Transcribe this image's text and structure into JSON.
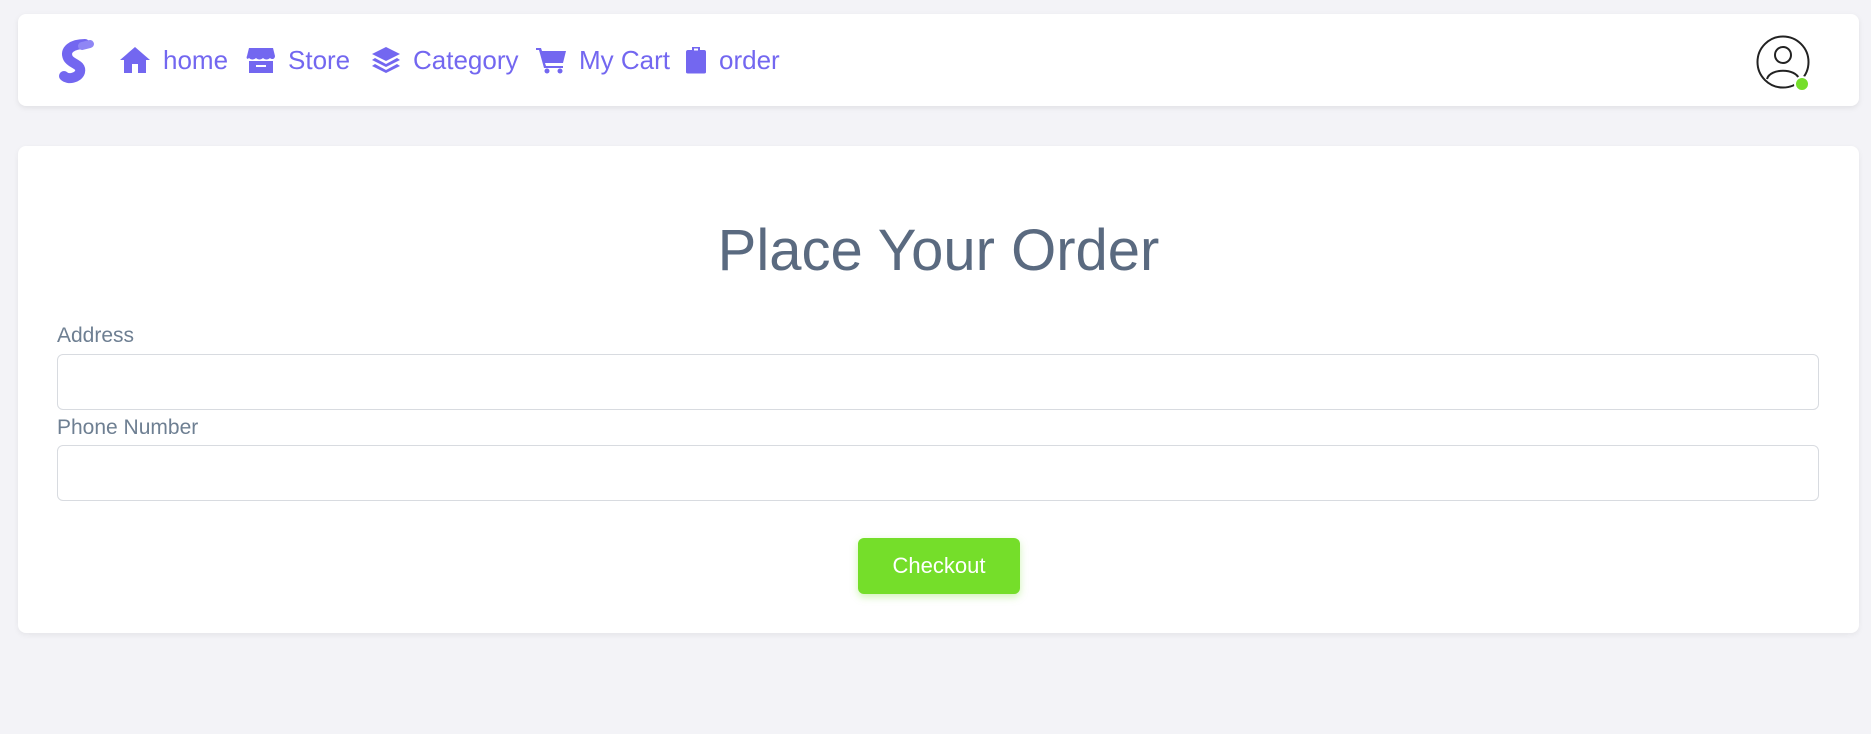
{
  "nav": {
    "logo_icon": "brand-s-logo",
    "items": [
      {
        "label": "home",
        "icon": "home-icon"
      },
      {
        "label": "Store",
        "icon": "store-icon"
      },
      {
        "label": "Category",
        "icon": "layers-icon"
      },
      {
        "label": "My Cart",
        "icon": "cart-icon"
      },
      {
        "label": "order",
        "icon": "clipboard-icon"
      }
    ],
    "user_icon": "user-avatar-icon",
    "status": "online"
  },
  "form": {
    "title": "Place Your Order",
    "address_label": "Address",
    "address_value": "",
    "phone_label": "Phone Number",
    "phone_value": "",
    "checkout_label": "Checkout"
  },
  "colors": {
    "accent": "#7367f0",
    "success": "#75de2a",
    "title": "#5a6a80",
    "background": "#f3f3f7"
  }
}
